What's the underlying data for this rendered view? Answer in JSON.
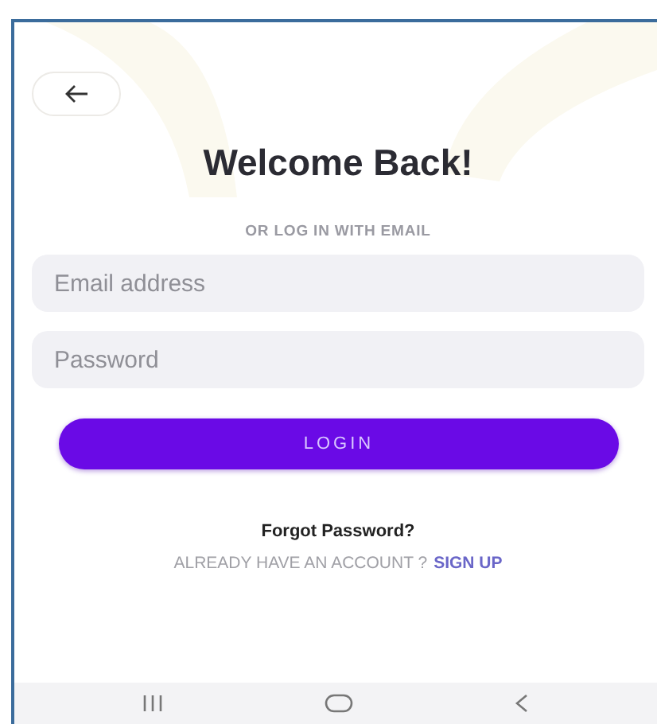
{
  "title": "Welcome Back!",
  "subtitle": "OR LOG IN WITH EMAIL",
  "fields": [
    {
      "placeholder": "Email address"
    },
    {
      "placeholder": "Password"
    }
  ],
  "login_button": "LOGIN",
  "forgot_link": "Forgot Password?",
  "signup": {
    "prompt": "ALREADY HAVE AN ACCOUNT ?",
    "link": "SIGN UP"
  }
}
